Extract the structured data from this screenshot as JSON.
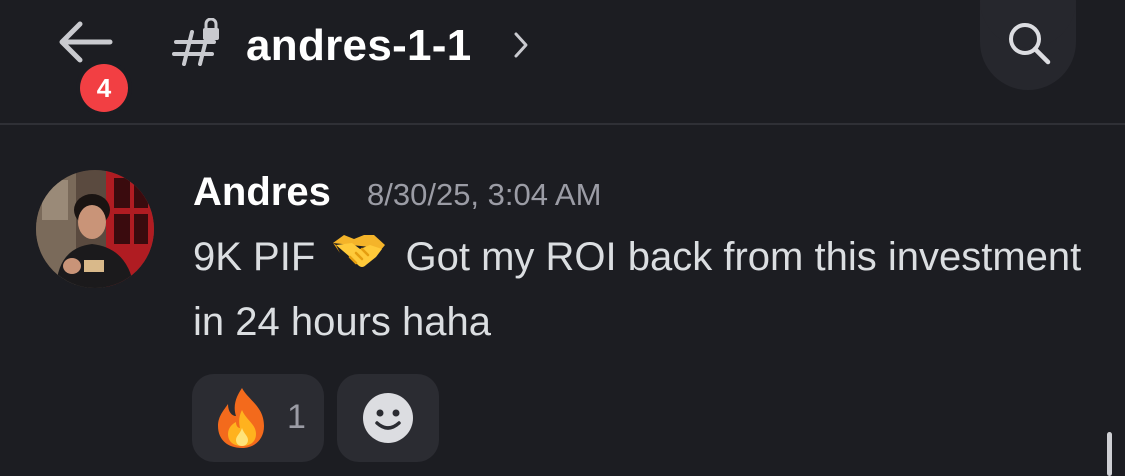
{
  "header": {
    "back_label": "Back",
    "badge_count": "4",
    "channel_name": "andres-1-1",
    "icons": {
      "back": "arrow-left-icon",
      "channel": "locked-channel-hash-icon",
      "chevron": "chevron-right-icon",
      "search": "search-icon"
    }
  },
  "message": {
    "author": "Andres",
    "timestamp": "8/30/25, 3:04 AM",
    "text_before_emoji": "9K PIF",
    "emoji": "handshake",
    "text_after_emoji": "Got my ROI back from this investment in 24 hours haha"
  },
  "reactions": [
    {
      "emoji": "fire",
      "count": "1"
    }
  ],
  "add_reaction_icon": "smiley-add-reaction-icon",
  "colors": {
    "background": "#1c1d22",
    "badge": "#f23f43",
    "timestamp": "#9b9ca5",
    "reaction_bg": "#2b2c32"
  }
}
